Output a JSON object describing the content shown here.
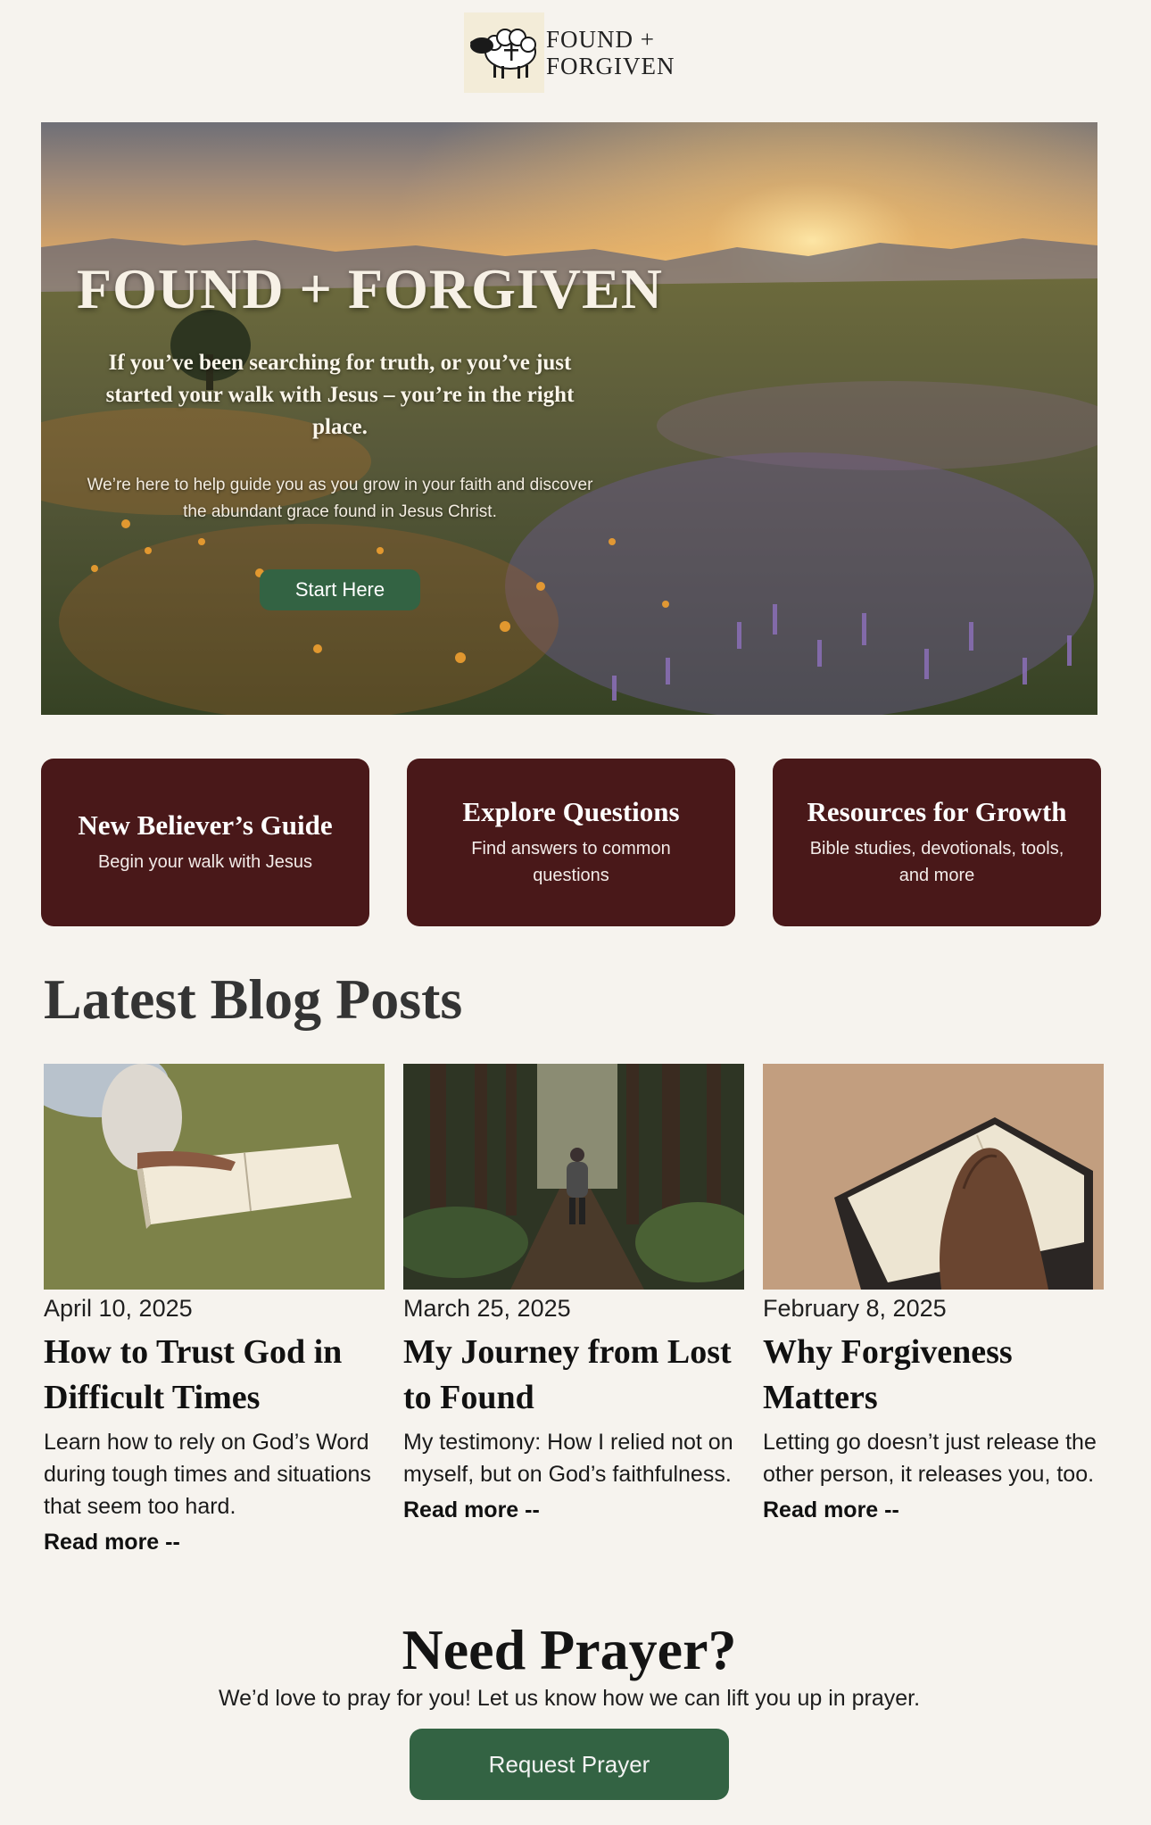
{
  "header": {
    "logo_line1": "FOUND +",
    "logo_line2": "FORGIVEN",
    "logo_icon": "sheep-cross-icon"
  },
  "hero": {
    "title": "FOUND + FORGIVEN",
    "subtitle": "If you’ve been searching for truth, or you’ve just started your walk with Jesus – you’re in the right place.",
    "body": "We’re here to help guide you as you grow in your faith and discover the abundant grace found in Jesus Christ.",
    "button_label": "Start Here"
  },
  "cards": [
    {
      "title": "New Believer’s Guide",
      "description": "Begin your walk with Jesus"
    },
    {
      "title": "Explore Questions",
      "description": "Find answers to common questions"
    },
    {
      "title": "Resources for Growth",
      "description": "Bible studies, devotionals, tools, and more"
    }
  ],
  "blog": {
    "section_title": "Latest Blog Posts",
    "posts": [
      {
        "date": "April 10, 2025",
        "title": "How to Trust God in Difficult Times",
        "excerpt": "Learn how to rely on God’s Word during tough times and situations that seem too hard.",
        "read_more": "Read more --"
      },
      {
        "date": "March 25, 2025",
        "title": "My Journey from Lost to Found",
        "excerpt": "My testimony: How I relied not on myself, but on God’s faithfulness.",
        "read_more": "Read more --"
      },
      {
        "date": "February 8, 2025",
        "title": "Why Forgiveness Matters",
        "excerpt": "Letting go doesn’t just release the other person, it releases you, too.",
        "read_more": "Read more --"
      }
    ]
  },
  "prayer": {
    "title": "Need Prayer?",
    "text": "We’d love to pray for you!  Let us know how we can lift you up in prayer.",
    "button_label": "Request Prayer"
  },
  "colors": {
    "background": "#f6f3ee",
    "card": "#491819",
    "button": "#336343"
  }
}
